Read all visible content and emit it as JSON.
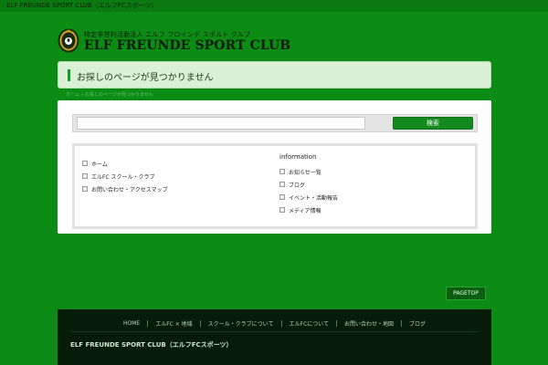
{
  "topbar": {
    "text": "ELF FREUNDE SPORT CLUB（エルフFCスポーツ）"
  },
  "header": {
    "logo_subtitle": "特定非営利活動法人 エルフ フロインデ スポルト クルブ",
    "logo_title": "ELF FREUNDE SPORT CLUB"
  },
  "page": {
    "title": "お探しのページが見つかりません",
    "breadcrumb": "ホーム » お探しのページが見つかりません"
  },
  "search": {
    "value": "",
    "button_label": "検索"
  },
  "sitemap": {
    "left_items": [
      {
        "label": "ホーム"
      },
      {
        "label": "エルFC スクール・クラブ"
      },
      {
        "label": "お問い合わせ・アクセスマップ"
      }
    ],
    "right_heading": "information",
    "right_items": [
      {
        "label": "お知らせ一覧"
      },
      {
        "label": "ブログ"
      },
      {
        "label": "イベント・活動報告"
      },
      {
        "label": "メディア情報"
      }
    ]
  },
  "pagetop": {
    "label": "PAGETOP"
  },
  "footer": {
    "nav": [
      {
        "label": "HOME"
      },
      {
        "label": "エルFC × 地域"
      },
      {
        "label": "スクール・クラブについて"
      },
      {
        "label": "エルFCについて"
      },
      {
        "label": "お問い合わせ・地図"
      },
      {
        "label": "ブログ"
      }
    ],
    "site_name": "ELF FREUNDE SPORT CLUB（エルフFCスポーツ）"
  },
  "colors": {
    "background": "#0c8c14",
    "accent": "#11a01c",
    "footer_bg": "#071c08"
  }
}
